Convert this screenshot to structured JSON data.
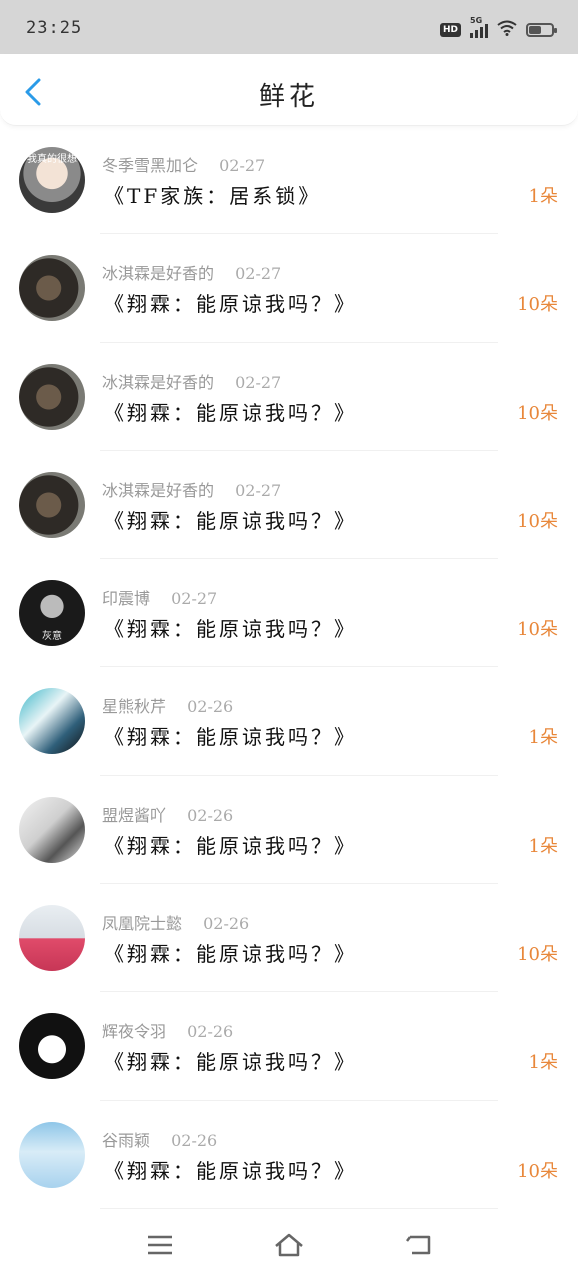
{
  "status_bar": {
    "time": "23:25",
    "hd": "HD",
    "network": "5G",
    "battery_level": 0.55
  },
  "header": {
    "title": "鲜花"
  },
  "accent_color": "#2b9be8",
  "count_color": "#e8873a",
  "items": [
    {
      "user": "冬季雪黑加仑",
      "date": "02-27",
      "work": "《TF家族：居系锁》",
      "count": "1朵",
      "avatar_text": "我真的很想"
    },
    {
      "user": "冰淇霖是好香的",
      "date": "02-27",
      "work": "《翔霖：能原谅我吗？》",
      "count": "10朵"
    },
    {
      "user": "冰淇霖是好香的",
      "date": "02-27",
      "work": "《翔霖：能原谅我吗？》",
      "count": "10朵"
    },
    {
      "user": "冰淇霖是好香的",
      "date": "02-27",
      "work": "《翔霖：能原谅我吗？》",
      "count": "10朵"
    },
    {
      "user": "印震博",
      "date": "02-27",
      "work": "《翔霖：能原谅我吗？》",
      "count": "10朵",
      "avatar_text": "灰意"
    },
    {
      "user": "星熊秋芹",
      "date": "02-26",
      "work": "《翔霖：能原谅我吗？》",
      "count": "1朵"
    },
    {
      "user": "盟煜酱吖",
      "date": "02-26",
      "work": "《翔霖：能原谅我吗？》",
      "count": "1朵"
    },
    {
      "user": "凤凰院士懿",
      "date": "02-26",
      "work": "《翔霖：能原谅我吗？》",
      "count": "10朵"
    },
    {
      "user": "辉夜令羽",
      "date": "02-26",
      "work": "《翔霖：能原谅我吗？》",
      "count": "1朵"
    },
    {
      "user": "谷雨颖",
      "date": "02-26",
      "work": "《翔霖：能原谅我吗？》",
      "count": "10朵"
    }
  ],
  "nav": {
    "menu_icon": "menu-icon",
    "home_icon": "home-icon",
    "back_icon": "back-arrow-icon"
  }
}
